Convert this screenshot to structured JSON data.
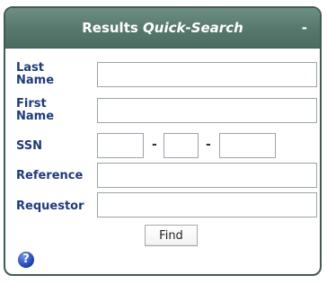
{
  "panel": {
    "title_main": "Results",
    "title_italic": "Quick-Search",
    "collapse_label": "-"
  },
  "form": {
    "last_name_line1": "Last",
    "last_name_line2": "Name",
    "first_name_line1": "First",
    "first_name_line2": "Name",
    "ssn_label": "SSN",
    "ssn_separator": "-",
    "reference_label": "Reference",
    "requestor_label": "Requestor",
    "find_label": "Find"
  },
  "icons": {
    "help": "help-icon",
    "help_glyph": "?"
  },
  "colors": {
    "header": "#56776c",
    "label": "#1f3b7a",
    "help": "#2a4fc0"
  }
}
